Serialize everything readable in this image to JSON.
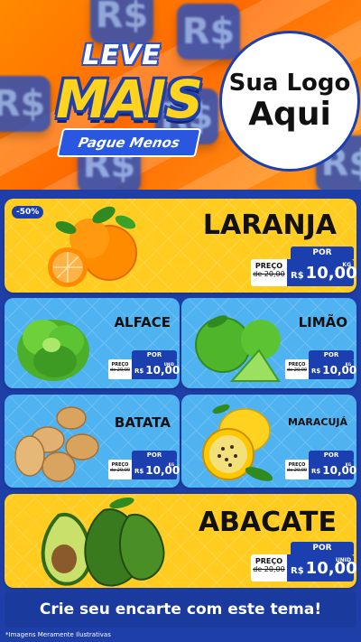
{
  "header": {
    "logo_top": "LEVE",
    "logo_main": "MAIS",
    "logo_sub": "Pague Menos",
    "logo_circle_line1": "Sua Logo",
    "logo_circle_line2": "Aqui",
    "tile_symbol": "R$"
  },
  "products": [
    {
      "name": "LARANJA",
      "badge": "-50%",
      "por": "POR",
      "preco": "PREÇO",
      "old": "de 20,00",
      "currency": "R$",
      "price": "10,00",
      "unit": "KG"
    },
    {
      "name": "ALFACE",
      "por": "POR",
      "preco": "PREÇO",
      "old": "de 20,00",
      "currency": "R$",
      "price": "10,00",
      "unit": "UNID"
    },
    {
      "name": "LIMÃO",
      "por": "POR",
      "preco": "PREÇO",
      "old": "de 20,00",
      "currency": "R$",
      "price": "10,00",
      "unit": "KG"
    },
    {
      "name": "BATATA",
      "por": "POR",
      "preco": "PREÇO",
      "old": "de 20,00",
      "currency": "R$",
      "price": "10,00",
      "unit": "KG"
    },
    {
      "name": "MARACUJÁ",
      "por": "POR",
      "preco": "PREÇO",
      "old": "de 20,00",
      "currency": "R$",
      "price": "10,00",
      "unit": "KG"
    },
    {
      "name": "ABACATE",
      "por": "POR",
      "preco": "PREÇO",
      "old": "de 20,00",
      "currency": "R$",
      "price": "10,00",
      "unit": "UNID"
    }
  ],
  "cta": "Crie seu encarte com este tema!",
  "footnote": "*Imagens Meramente Ilustrativas",
  "colors": {
    "orange": "#ff7a00",
    "yellow": "#ffcc1f",
    "blue": "#4fb3f2",
    "navy": "#1c3fb0"
  }
}
